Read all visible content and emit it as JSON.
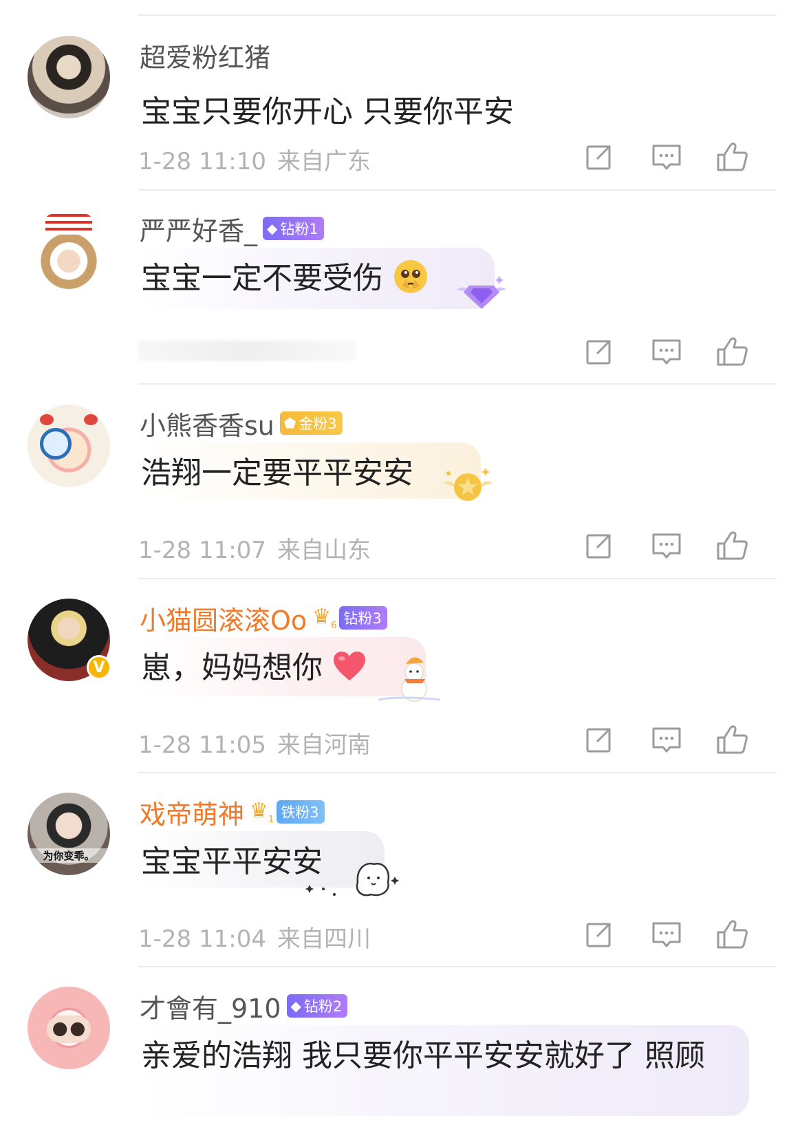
{
  "comments": [
    {
      "name": "超爱粉红猪",
      "text": "宝宝只要你开心 只要你平安",
      "time": "1-28 11:10",
      "location": "来自广东"
    },
    {
      "name": "严严好香_",
      "badge": "钻粉1",
      "text": "宝宝一定不要受伤",
      "emoji": "pleading-face-emoji"
    },
    {
      "name": "小熊香香su",
      "badge": "金粉3",
      "text": "浩翔一定要平平安安",
      "time": "1-28 11:07",
      "location": "来自山东"
    },
    {
      "name": "小猫圆滚滚Oo",
      "badge": "钻粉3",
      "text": "崽，妈妈想你",
      "emoji": "heart-emoji",
      "time": "1-28 11:05",
      "location": "来自河南",
      "verified_mark": "V",
      "crown_level": "6"
    },
    {
      "name": "戏帝萌神",
      "badge": "铁粉3",
      "text": "宝宝平平安安",
      "avatar_caption": "为你变乖。",
      "time": "1-28 11:04",
      "location": "来自四川",
      "crown_level": "1"
    },
    {
      "name": "才會有_910",
      "badge": "钻粉2",
      "text": "亲爱的浩翔 我只要你平平安安就好了 照顾"
    }
  ],
  "icons": {
    "share": "share-icon",
    "reply": "comment-icon",
    "like": "thumbs-up-icon"
  },
  "colors": {
    "username_default": "#555555",
    "username_highlight": "#f07a2a",
    "meta_text": "#b3b3b3",
    "diamond_badge": "#8a6cf6",
    "gold_badge": "#f6b93b",
    "iron_badge": "#5fa8f5",
    "verified": "#f7b500"
  }
}
